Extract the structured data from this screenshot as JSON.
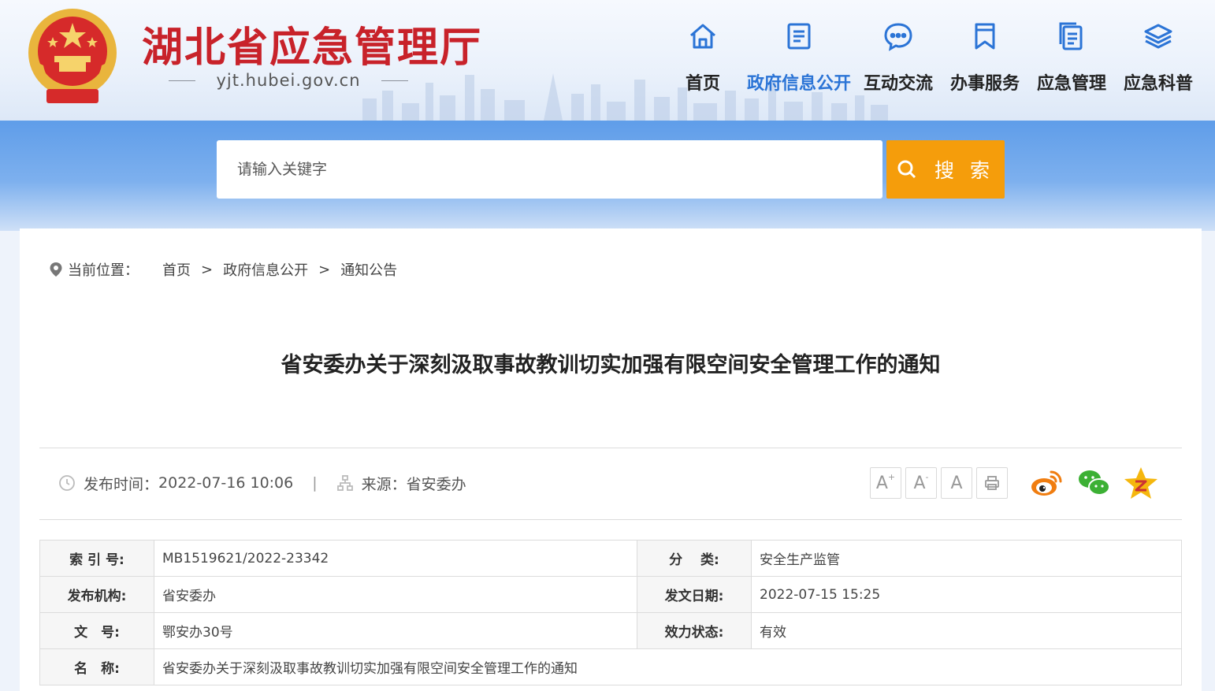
{
  "header": {
    "site_title": "湖北省应急管理厅",
    "site_domain": "yjt.hubei.gov.cn",
    "brand_color": "#c8222a"
  },
  "nav": {
    "items": [
      {
        "label": "首页",
        "icon": "home-icon",
        "active": false
      },
      {
        "label": "政府信息公开",
        "icon": "document-icon",
        "active": true
      },
      {
        "label": "互动交流",
        "icon": "chat-icon",
        "active": false
      },
      {
        "label": "办事服务",
        "icon": "bookmark-icon",
        "active": false
      },
      {
        "label": "应急管理",
        "icon": "files-icon",
        "active": false
      },
      {
        "label": "应急科普",
        "icon": "layers-icon",
        "active": false
      }
    ],
    "active_color": "#2b74d6"
  },
  "search": {
    "placeholder": "请输入关键字",
    "button_label": "搜 索",
    "button_color": "#f59d0b"
  },
  "breadcrumb": {
    "label": "当前位置：",
    "items": [
      "首页",
      "政府信息公开",
      "通知公告"
    ],
    "separator": ">"
  },
  "article": {
    "title": "省安委办关于深刻汲取事故教训切实加强有限空间安全管理工作的通知",
    "publish_label": "发布时间：",
    "publish_time": "2022-07-16 10:06",
    "source_label": "来源：",
    "source": "省安委办",
    "meta_separator": "|"
  },
  "tools": {
    "font_increase": "A",
    "font_decrease": "A",
    "font_reset": "A",
    "font_increase_mark": "+",
    "font_decrease_mark": "-"
  },
  "info": {
    "index_label": "索 引 号:",
    "index_value": "MB1519621/2022-23342",
    "category_label": "分　 类:",
    "category_value": "安全生产监管",
    "issuer_label": "发布机构:",
    "issuer_value": "省安委办",
    "date_label": "发文日期:",
    "date_value": "2022-07-15 15:25",
    "docno_label": "文　号:",
    "docno_value": "鄂安办30号",
    "status_label": "效力状态:",
    "status_value": "有效",
    "name_label": "名　称:",
    "name_value": "省安委办关于深刻汲取事故教训切实加强有限空间安全管理工作的通知"
  }
}
